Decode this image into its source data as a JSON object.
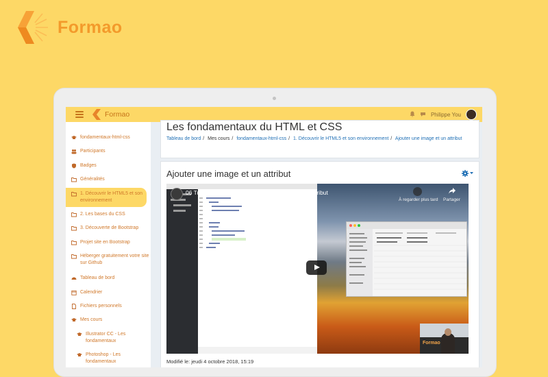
{
  "brand": {
    "name": "Formao"
  },
  "topbar": {
    "site_name": "Formao",
    "user_name": "Philippe You"
  },
  "sidebar": {
    "items": [
      {
        "label": "fondamentaux-html-css",
        "icon": "graduation-cap-icon"
      },
      {
        "label": "Participants",
        "icon": "users-icon"
      },
      {
        "label": "Badges",
        "icon": "shield-icon"
      },
      {
        "label": "Généralités",
        "icon": "folder-icon"
      },
      {
        "label": "1. Découvrir le HTML5 et son environnement",
        "icon": "folder-icon",
        "active": true
      },
      {
        "label": "2. Les bases du CSS",
        "icon": "folder-icon"
      },
      {
        "label": "3. Découverte de Bootstrap",
        "icon": "folder-icon"
      },
      {
        "label": "Projet site en Bootstrap",
        "icon": "folder-icon"
      },
      {
        "label": "Héberger gratuitement votre site sur Github",
        "icon": "folder-icon"
      },
      {
        "label": "Tableau de bord",
        "icon": "dashboard-icon"
      },
      {
        "label": "Calendrier",
        "icon": "calendar-icon"
      },
      {
        "label": "Fichiers personnels",
        "icon": "file-icon"
      },
      {
        "label": "Mes cours",
        "icon": "graduation-cap-icon"
      },
      {
        "label": "Illustrator CC - Les fondamentaux",
        "icon": "graduation-cap-icon"
      },
      {
        "label": "Photoshop - Les fondamentaux",
        "icon": "graduation-cap-icon"
      }
    ]
  },
  "page": {
    "title": "Les fondamentaux du HTML et CSS",
    "breadcrumbs": [
      "Tableau de bord",
      "Mes cours",
      "fondamentaux-html-css",
      "1. Découvrir le HTML5 et son environnement",
      "Ajouter une image et un attribut"
    ],
    "section_title": "Ajouter une image et un attribut",
    "modified": "Modifié le: jeudi 4 octobre 2018, 15:19"
  },
  "video": {
    "title": "06 Tutorial HTML_CSS Ajouter une image et un attribut",
    "watch_later": "À regarder plus tard",
    "share": "Partager",
    "watermark": "Formao"
  },
  "colors": {
    "background": "#fdd866",
    "brand_orange": "#f39a2b",
    "link": "#1f6fb5",
    "nav_text": "#d0782a"
  }
}
